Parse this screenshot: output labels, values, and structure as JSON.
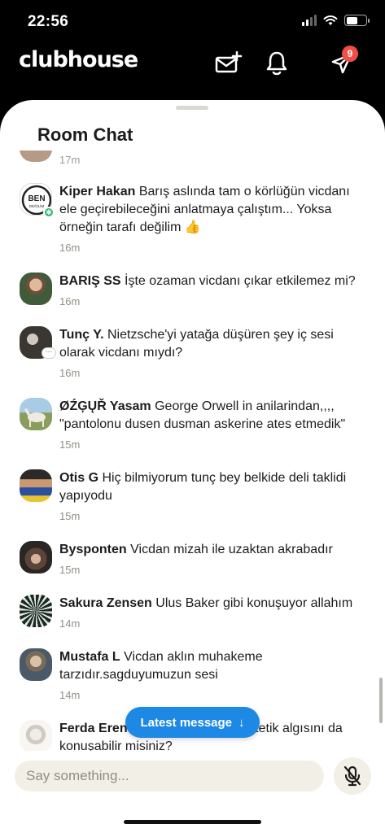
{
  "status_bar": {
    "time": "22:56",
    "battery_level": 0.6
  },
  "header": {
    "logo": "clubhouse",
    "notification_badge": "9",
    "icons": [
      "compose-message-icon",
      "bell-icon",
      "send-icon"
    ]
  },
  "sheet": {
    "title": "Room Chat"
  },
  "chat": {
    "partial_time": "17m",
    "messages": [
      {
        "name": "Kiper Hakan",
        "text": "Barış aslında tam o körlüğün vicdanı ele geçirebileceğini anlatmaya çalıştım... Yoksa örneğin tarafı değilim 👍",
        "time": "16m",
        "avatar_label": "BEN DEĞİLİM"
      },
      {
        "name": "BARIŞ SS",
        "text": "İşte ozaman vicdanı çıkar etkilemez mi?",
        "time": "16m"
      },
      {
        "name": "Tunç Y.",
        "text": "Nietzsche'yi yatağa düşüren şey iç sesi olarak vicdanı mıydı?",
        "time": "16m"
      },
      {
        "name": "ØŹĢŲŘ Yasam",
        "text": "George Orwell in anilarindan,,,, \"pantolonu dusen dusman askerine ates etmedik\"",
        "time": "15m"
      },
      {
        "name": "Otis G",
        "text": "Hiç bilmiyorum tunç bey belkide deli taklidi yapıyodu",
        "time": "15m"
      },
      {
        "name": "Bysponten",
        "text": "Vicdan mizah ile uzaktan akrabadır",
        "time": "15m"
      },
      {
        "name": "Sakura Zensen",
        "text": "Ulus Baker gibi konuşuyor allahım",
        "time": "14m"
      },
      {
        "name": "Mustafa L",
        "text": "Vicdan aklın muhakeme tarzıdır.sagduyumuzun sesi",
        "time": "14m"
      },
      {
        "name": "Ferda Eren",
        "text": "şu sorduğunu yani estetik algısını da konuşabilir misiniz?",
        "time": ""
      }
    ]
  },
  "latest_button": {
    "label": "Latest message",
    "arrow": "↓"
  },
  "input": {
    "placeholder": "Say something..."
  },
  "colors": {
    "accent": "#1e88e5",
    "badge": "#ef4f45",
    "input_bg": "#f1efe6",
    "moderator": "#2bb673"
  }
}
